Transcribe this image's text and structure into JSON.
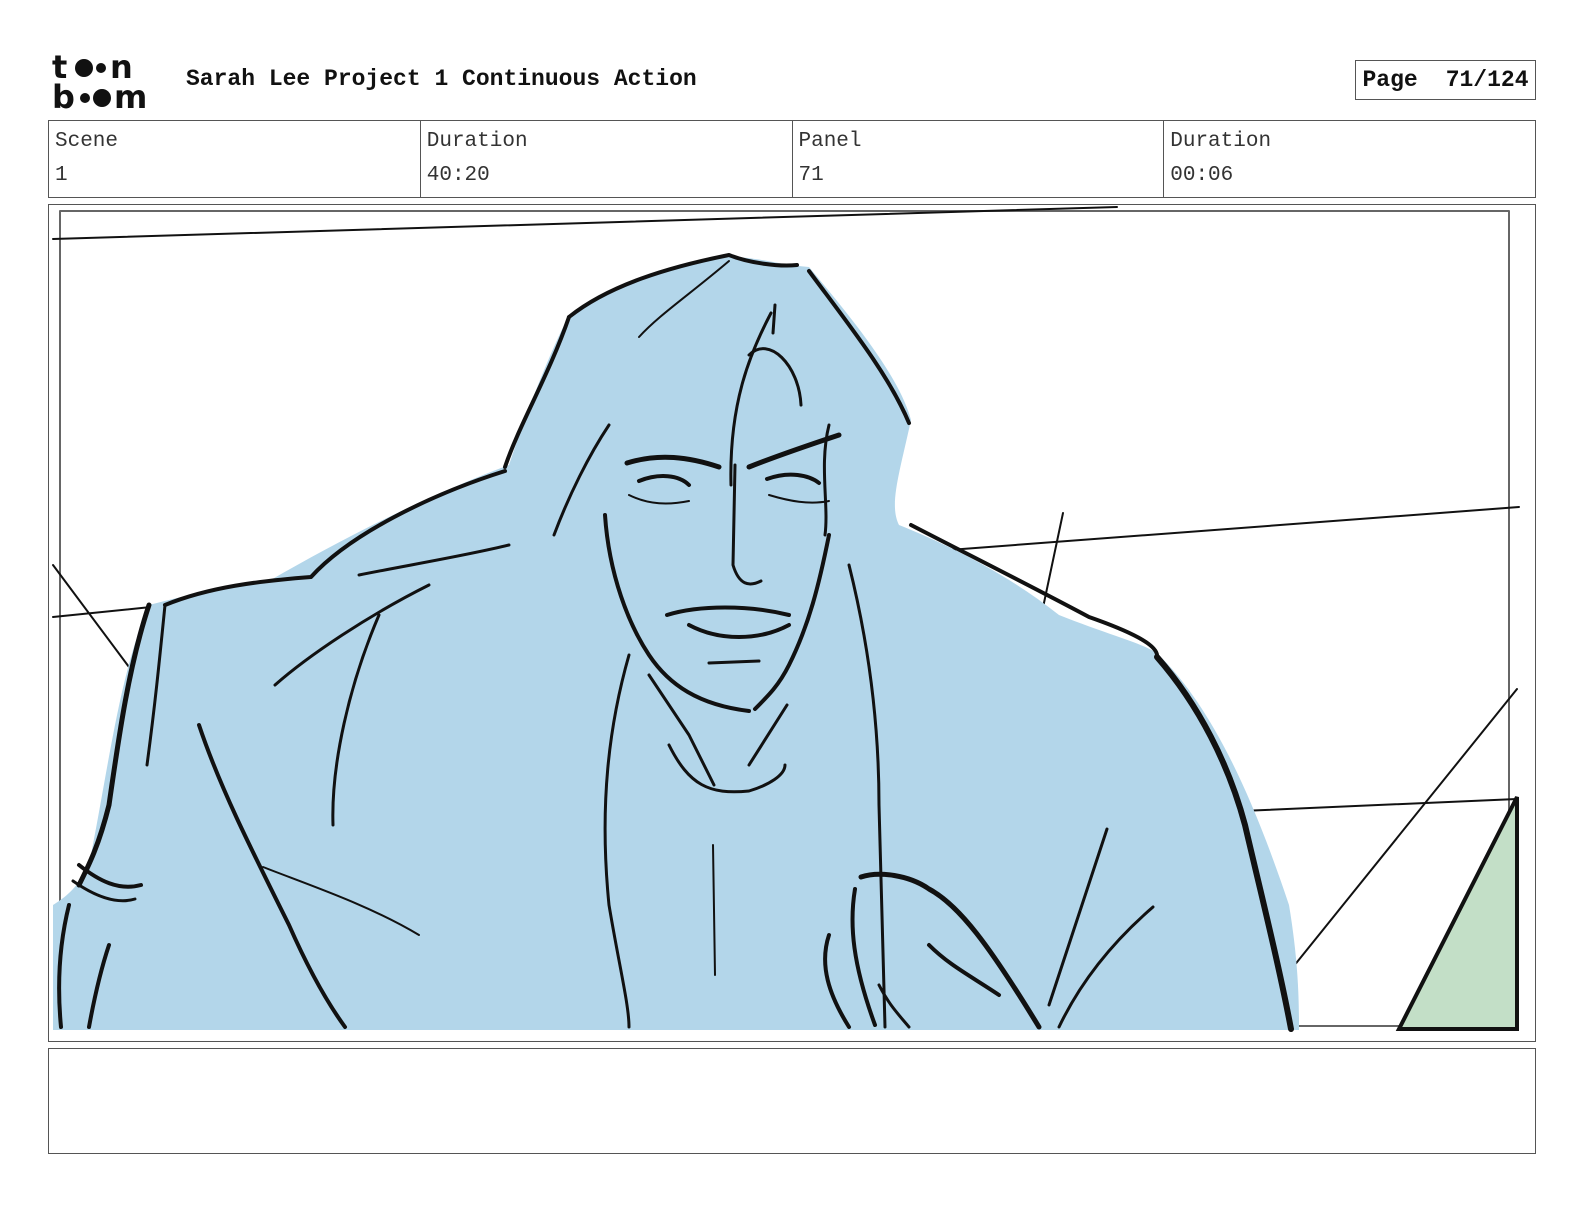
{
  "header": {
    "logo_text": "toon boom",
    "project_title": "Sarah Lee Project 1 Continuous Action",
    "page_label": "Page",
    "page_value": "71/124"
  },
  "info": {
    "scene_label": "Scene",
    "scene_value": "1",
    "scene_duration_label": "Duration",
    "scene_duration_value": "40:20",
    "panel_label": "Panel",
    "panel_value": "71",
    "panel_duration_label": "Duration",
    "panel_duration_value": "00:06"
  },
  "panel": {
    "character_color": "#b3d6ea",
    "background_object_color": "#c3dfc7",
    "line_color": "#111111"
  },
  "caption": {
    "text": ""
  }
}
